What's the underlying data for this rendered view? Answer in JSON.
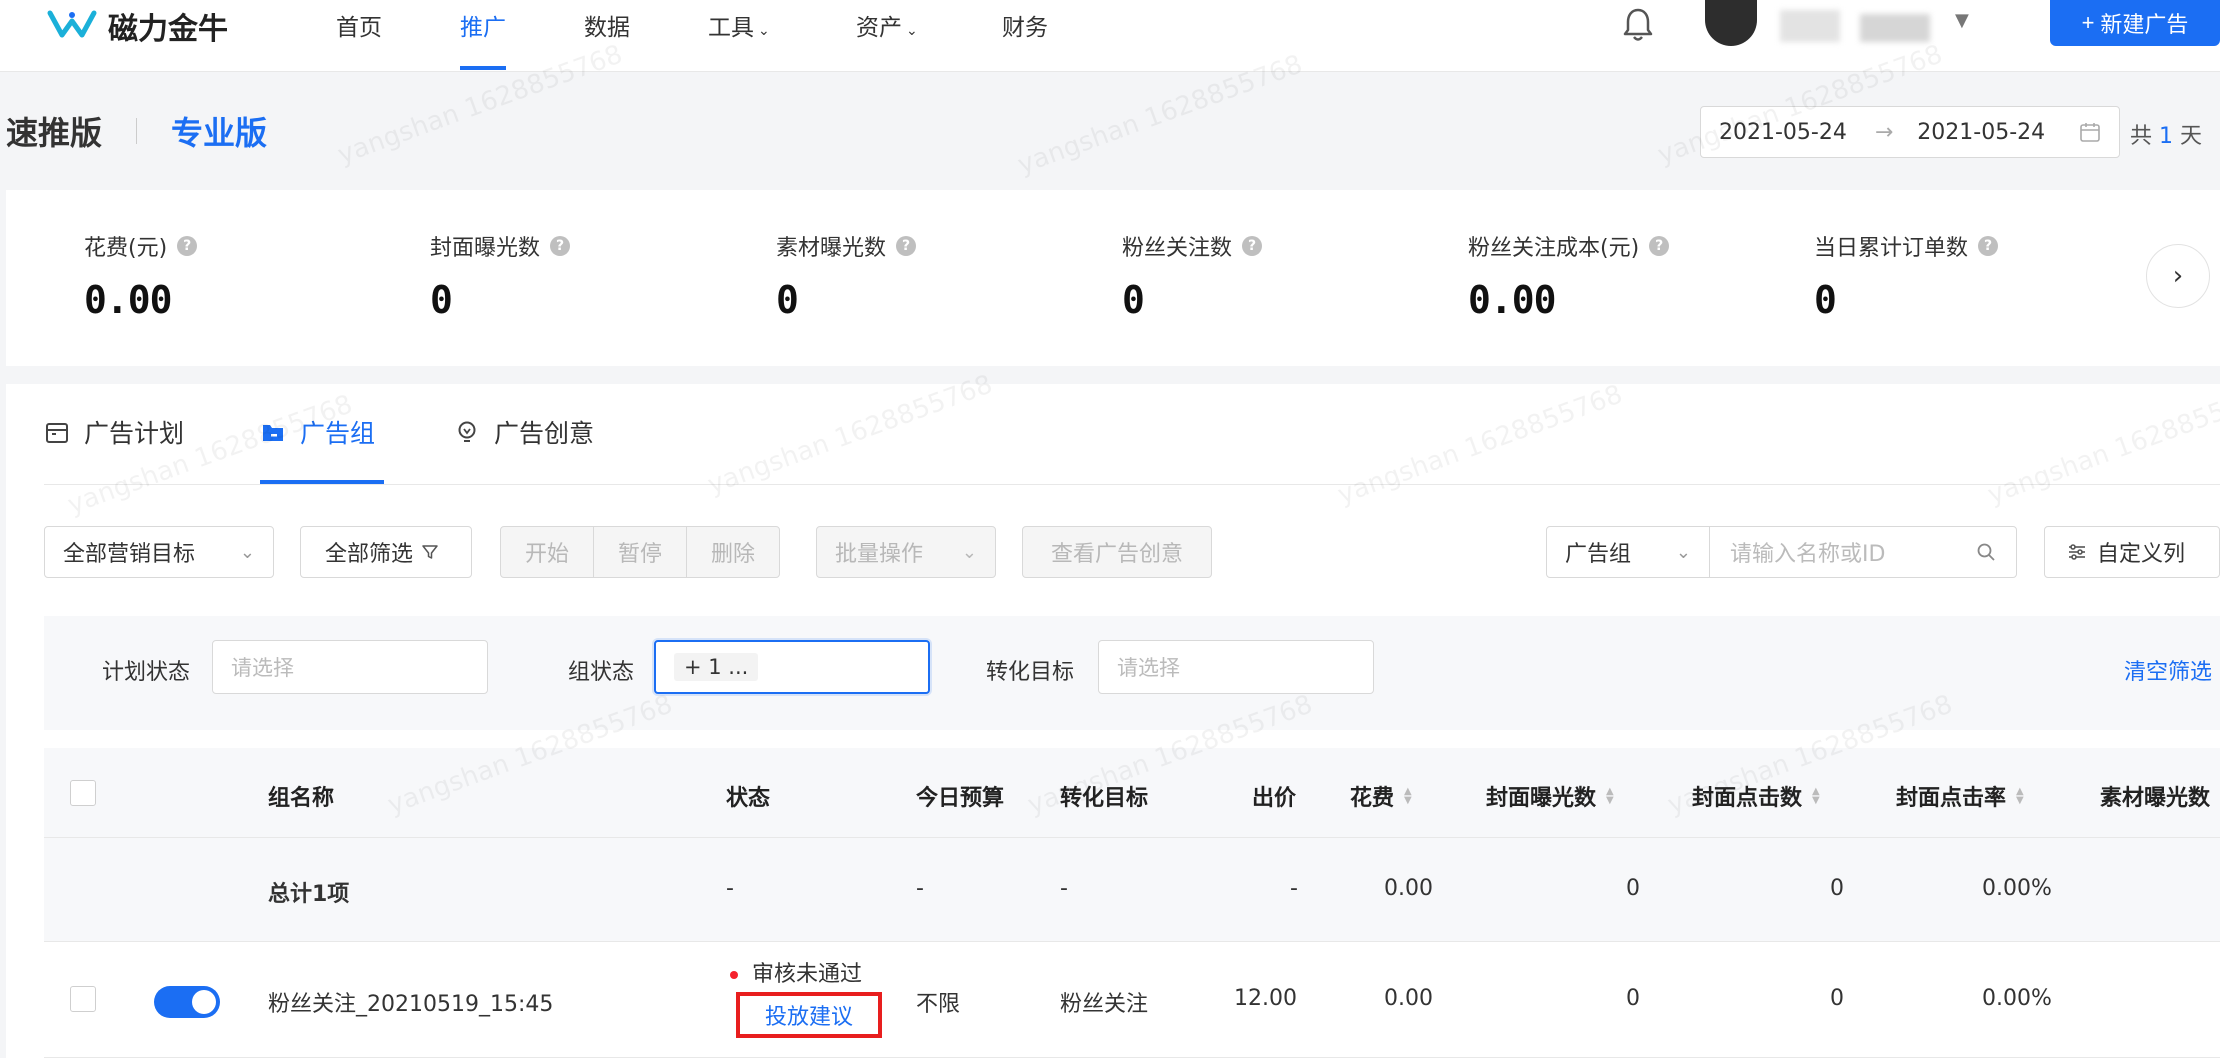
{
  "topnav": {
    "logo_text": "磁力金牛",
    "items": [
      {
        "label": "首页",
        "dropdown": false
      },
      {
        "label": "推广",
        "dropdown": false
      },
      {
        "label": "数据",
        "dropdown": false
      },
      {
        "label": "工具",
        "dropdown": true
      },
      {
        "label": "资产",
        "dropdown": true
      },
      {
        "label": "财务",
        "dropdown": false
      }
    ],
    "active_item": "推广",
    "new_ad_label": "新建广告"
  },
  "header": {
    "version_tabs": [
      "速推版",
      "专业版"
    ],
    "active_version": "专业版",
    "date_start": "2021-05-24",
    "date_end": "2021-05-24",
    "day_prefix": "共",
    "day_count": "1",
    "day_suffix": "天"
  },
  "metrics": [
    {
      "label": "花费(元)",
      "value": "0.00"
    },
    {
      "label": "封面曝光数",
      "value": "0"
    },
    {
      "label": "素材曝光数",
      "value": "0"
    },
    {
      "label": "粉丝关注数",
      "value": "0"
    },
    {
      "label": "粉丝关注成本(元)",
      "value": "0.00"
    },
    {
      "label": "当日累计订单数",
      "value": "0"
    }
  ],
  "level_tabs": [
    {
      "label": "广告计划",
      "icon": "calendar-icon"
    },
    {
      "label": "广告组",
      "icon": "folder-icon"
    },
    {
      "label": "广告创意",
      "icon": "bulb-icon"
    }
  ],
  "active_level_tab": "广告组",
  "toolbar": {
    "goal_select": "全部营销目标",
    "filter_label": "全部筛选",
    "batch_buttons": [
      "开始",
      "暂停",
      "删除"
    ],
    "batch_ops": "批量操作",
    "view_creative": "查看广告创意",
    "search_scope": "广告组",
    "search_placeholder": "请输入名称或ID",
    "custom_columns": "自定义列"
  },
  "filters": {
    "plan_status_label": "计划状态",
    "plan_status_placeholder": "请选择",
    "group_status_label": "组状态",
    "group_status_value": "+ 1 ...",
    "conversion_label": "转化目标",
    "conversion_placeholder": "请选择",
    "clear_label": "清空筛选"
  },
  "table": {
    "columns": [
      "组名称",
      "状态",
      "今日预算",
      "转化目标",
      "出价",
      "花费",
      "封面曝光数",
      "封面点击数",
      "封面点击率",
      "素材曝光数"
    ],
    "total": {
      "name": "总计1项",
      "status": "-",
      "budget": "-",
      "conversion": "-",
      "bid": "-",
      "cost": "0.00",
      "cover_exposure": "0",
      "cover_clicks": "0",
      "cover_ctr": "0.00%"
    },
    "rows": [
      {
        "name": "粉丝关注_20210519_15:45",
        "status": "审核未通过",
        "advice": "投放建议",
        "budget": "不限",
        "conversion": "粉丝关注",
        "bid": "12.00",
        "cost": "0.00",
        "cover_exposure": "0",
        "cover_clicks": "0",
        "cover_ctr": "0.00%"
      }
    ]
  },
  "watermark": "yangshan 1628855768",
  "colors": {
    "brand": "#1b6ef3",
    "error": "#f5222d",
    "highlight_box": "#e81e1e"
  }
}
